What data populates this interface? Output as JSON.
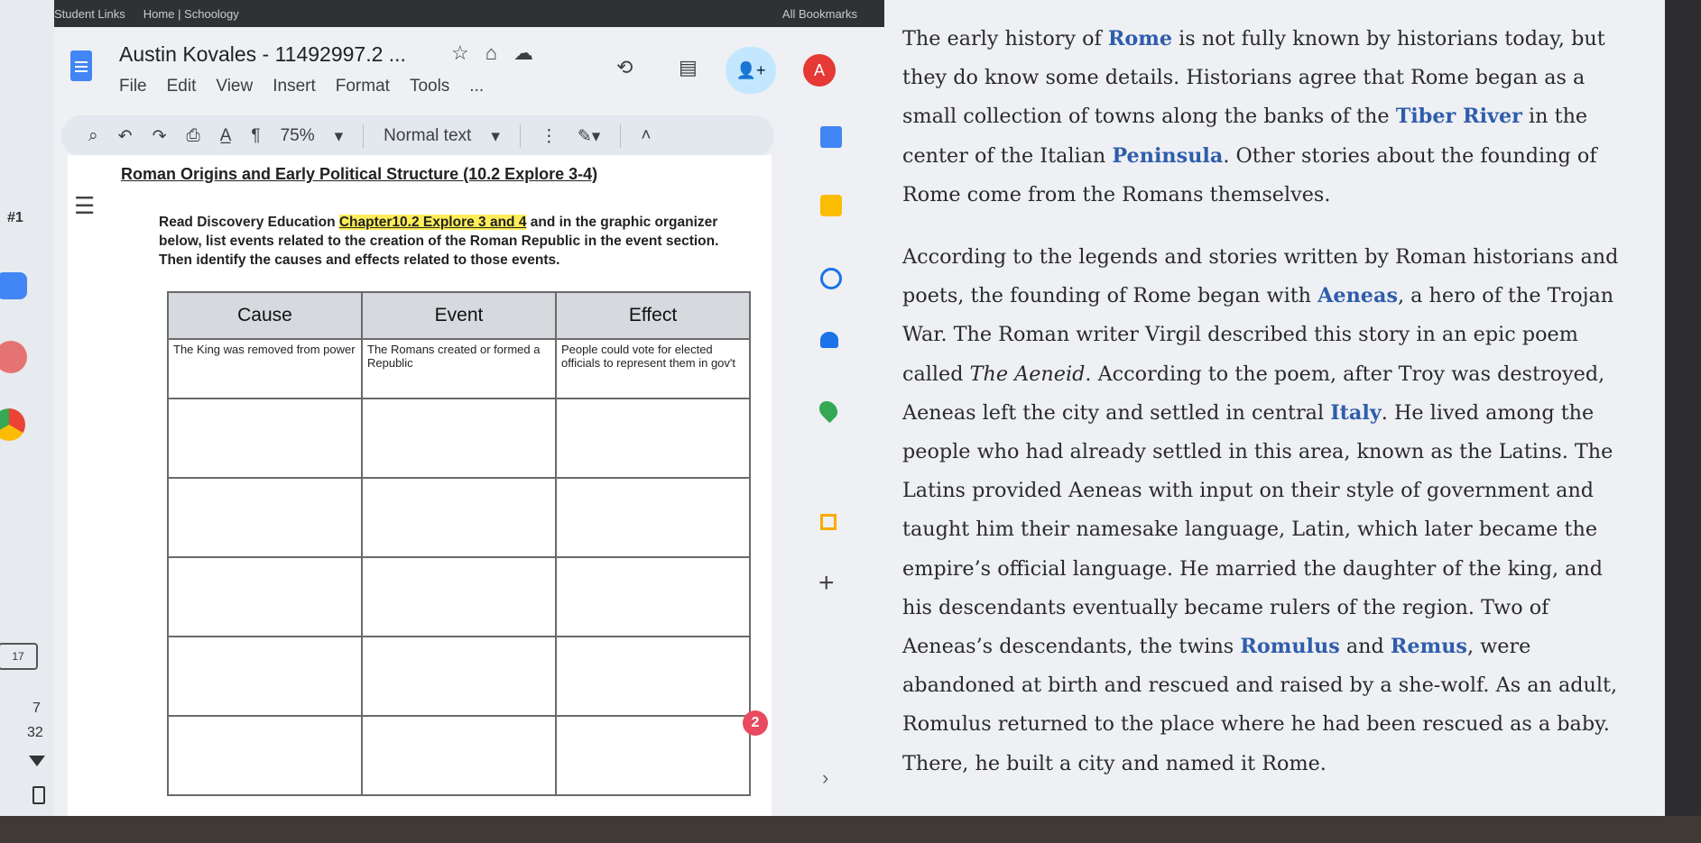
{
  "browser": {
    "bookmarks": [
      "Student Links",
      "Home | Schoology"
    ],
    "all_bookmarks": "All Bookmarks"
  },
  "doc": {
    "title": "Austin Kovales - 11492997.2 ...",
    "menu": [
      "File",
      "Edit",
      "View",
      "Insert",
      "Format",
      "Tools",
      "..."
    ],
    "avatar_letter": "A",
    "toolbar": {
      "zoom": "75%",
      "style": "Normal text"
    },
    "heading": "Roman Origins and Early Political Structure (10.2 Explore 3-4)",
    "question_number": "#1",
    "instructions": {
      "before": "Read Discovery Education ",
      "highlight": "Chapter10.2 Explore 3 and 4",
      "after": " and in the graphic organizer below, list events related to the creation of the Roman Republic in the event section.  Then identify the causes and effects related to those events."
    },
    "table": {
      "headers": [
        "Cause",
        "Event",
        "Effect"
      ],
      "first_row": [
        "The King was removed  from power",
        "The Romans created or formed a Republic",
        "People could vote for elected officials to represent them in gov't"
      ]
    },
    "comment_badge": "2"
  },
  "left_rail": {
    "calendar_day": "17",
    "count_top": "7",
    "count_bottom": "32"
  },
  "reading": {
    "p1": [
      {
        "t": "The early history of "
      },
      {
        "t": "Rome",
        "h": true
      },
      {
        "t": " is not fully known by historians today, but they do know some details. Historians agree that Rome began as a small collection of towns along the banks of the "
      },
      {
        "t": "Tiber River",
        "h": true
      },
      {
        "t": " in the center of the Italian "
      },
      {
        "t": "Peninsula",
        "h": true
      },
      {
        "t": ". Other stories about the founding of Rome come from the Romans themselves."
      }
    ],
    "p2": [
      {
        "t": "According to the legends and stories written by Roman historians and poets, the founding of Rome began with "
      },
      {
        "t": "Aeneas",
        "h": true
      },
      {
        "t": ", a hero of the Trojan War. The Roman writer Virgil described this story in an epic poem called "
      },
      {
        "t": "The Aeneid",
        "i": true
      },
      {
        "t": ". According to the poem, after Troy was destroyed, Aeneas left the city and settled in central "
      },
      {
        "t": "Italy",
        "h": true
      },
      {
        "t": ". He lived among the people who had already settled in this area, known as the Latins. The Latins provided Aeneas with input on their style of government and taught him their namesake language, Latin, which later became the empire’s official language. He married the daughter of the king, and his descendants eventually became rulers of the region. Two of Aeneas’s descendants, the twins "
      },
      {
        "t": "Romulus",
        "h": true
      },
      {
        "t": " and "
      },
      {
        "t": "Remus",
        "h": true
      },
      {
        "t": ", were abandoned at birth and rescued and raised by a she-wolf. As an adult, Romulus returned to the place where he had been rescued as a baby. There, he built a city and named it Rome."
      }
    ]
  }
}
